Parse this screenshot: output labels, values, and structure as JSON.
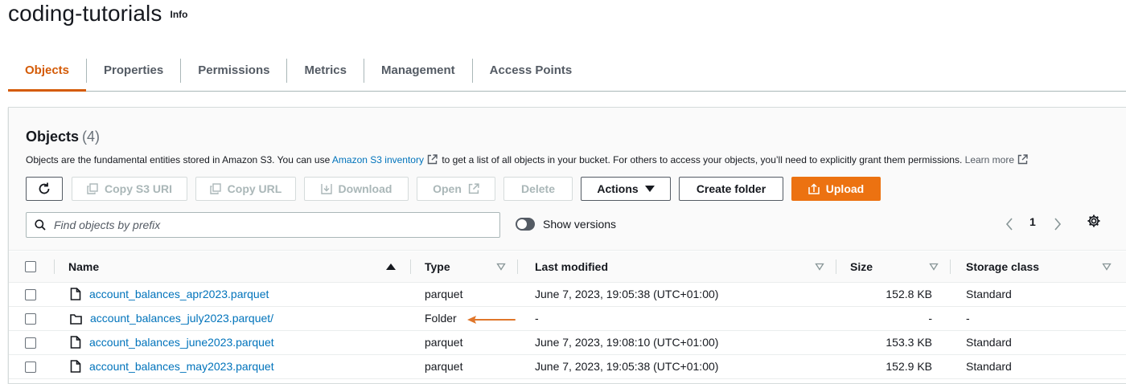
{
  "header": {
    "title": "coding-tutorials",
    "info": "Info"
  },
  "tabs": [
    {
      "label": "Objects",
      "active": true
    },
    {
      "label": "Properties",
      "active": false
    },
    {
      "label": "Permissions",
      "active": false
    },
    {
      "label": "Metrics",
      "active": false
    },
    {
      "label": "Management",
      "active": false
    },
    {
      "label": "Access Points",
      "active": false
    }
  ],
  "objects": {
    "title": "Objects",
    "count": "(4)",
    "description": {
      "part1": "Objects are the fundamental entities stored in Amazon S3. You can use",
      "link1": "Amazon S3 inventory",
      "part2": "to get a list of all objects in your bucket. For others to access your objects, you’ll need to explicitly grant them permissions.",
      "link2": "Learn more"
    },
    "toolbar": {
      "copy_s3_uri": "Copy S3 URI",
      "copy_url": "Copy URL",
      "download": "Download",
      "open": "Open",
      "delete": "Delete",
      "actions": "Actions",
      "create_folder": "Create folder",
      "upload": "Upload"
    },
    "search": {
      "placeholder": "Find objects by prefix",
      "value": ""
    },
    "show_versions": {
      "label": "Show versions",
      "enabled": false
    },
    "pagination": {
      "current_page": "1"
    },
    "columns": {
      "name": "Name",
      "type": "Type",
      "last_modified": "Last modified",
      "size": "Size",
      "storage_class": "Storage class"
    },
    "rows": [
      {
        "name": "account_balances_apr2023.parquet",
        "icon": "file-icon",
        "type": "parquet",
        "last_modified": "June 7, 2023, 19:05:38 (UTC+01:00)",
        "size": "152.8 KB",
        "storage_class": "Standard"
      },
      {
        "name": "account_balances_july2023.parquet/",
        "icon": "folder-icon",
        "type": "Folder",
        "last_modified": "-",
        "size": "-",
        "storage_class": "-"
      },
      {
        "name": "account_balances_june2023.parquet",
        "icon": "file-icon",
        "type": "parquet",
        "last_modified": "June 7, 2023, 19:08:10 (UTC+01:00)",
        "size": "153.3 KB",
        "storage_class": "Standard"
      },
      {
        "name": "account_balances_may2023.parquet",
        "icon": "file-icon",
        "type": "parquet",
        "last_modified": "June 7, 2023, 19:05:38 (UTC+01:00)",
        "size": "152.9 KB",
        "storage_class": "Standard"
      }
    ]
  },
  "colors": {
    "accent": "#d45b07",
    "primary_button": "#ec7211",
    "link": "#0073bb",
    "annotation_arrow": "#e0762a"
  }
}
